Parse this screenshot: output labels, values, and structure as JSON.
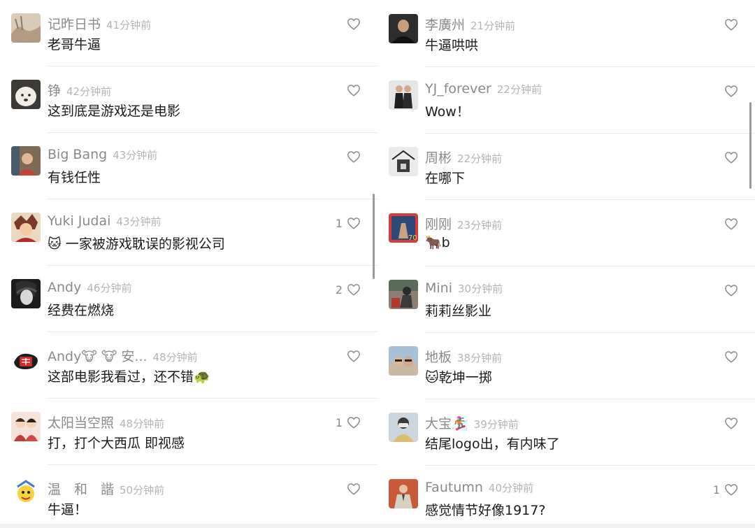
{
  "columns": [
    {
      "comments": [
        {
          "username": "记昨日书",
          "time": "41分钟前",
          "text": "老哥牛逼",
          "likes": "",
          "avatar_icon": "landscape-avatar-icon"
        },
        {
          "username": "铮",
          "time": "42分钟前",
          "text": "这到底是游戏还是电影",
          "likes": "",
          "avatar_icon": "dog-avatar-icon"
        },
        {
          "username": "Big Bang",
          "time": "43分钟前",
          "text": "有钱任性",
          "likes": "",
          "avatar_icon": "person-avatar-icon"
        },
        {
          "username": "Yuki Judai",
          "time": "43分钟前",
          "text": "🐱 一家被游戏耽误的影视公司",
          "likes": "1",
          "avatar_icon": "anime-avatar-icon"
        },
        {
          "username": "Andy",
          "time": "46分钟前",
          "text": "经费在燃烧",
          "likes": "2",
          "avatar_icon": "bw-portrait-avatar-icon"
        },
        {
          "username": "Andy🐮 🐮 安...",
          "time": "48分钟前",
          "text": "这部电影我看过，还不错🐢",
          "likes": "",
          "avatar_icon": "seal-logo-avatar-icon"
        },
        {
          "username": "太阳当空照",
          "time": "48分钟前",
          "text": "打，打个大西瓜 即视感",
          "likes": "1",
          "avatar_icon": "couple-cartoon-avatar-icon"
        },
        {
          "username": "温　和　諧",
          "time": "50分钟前",
          "text": "牛逼！",
          "likes": "",
          "avatar_icon": "cartoon-character-avatar-icon"
        }
      ]
    },
    {
      "comments": [
        {
          "username": "李廣州",
          "time": "21分钟前",
          "text": "牛逼哄哄",
          "likes": "",
          "avatar_icon": "man-portrait-avatar-icon"
        },
        {
          "username": "YJ_forever",
          "time": "22分钟前",
          "text": "Wow！",
          "likes": "",
          "avatar_icon": "couple-photo-avatar-icon"
        },
        {
          "username": "周彬",
          "time": "22分钟前",
          "text": "在哪下",
          "likes": "",
          "avatar_icon": "sketch-house-avatar-icon"
        },
        {
          "username": "刚刚",
          "time": "23分钟前",
          "text": "🐂b",
          "likes": "",
          "avatar_icon": "poster-avatar-icon"
        },
        {
          "username": "Mini",
          "time": "30分钟前",
          "text": "莉莉丝影业",
          "likes": "",
          "avatar_icon": "street-photo-avatar-icon"
        },
        {
          "username": "地板",
          "time": "38分钟前",
          "text": "🐱乾坤一掷",
          "likes": "",
          "avatar_icon": "selfie-avatar-icon"
        },
        {
          "username": "大宝🏂",
          "time": "39分钟前",
          "text": "结尾logo出，有内味了",
          "likes": "",
          "avatar_icon": "masked-person-avatar-icon"
        },
        {
          "username": "Fautumn",
          "time": "40分钟前",
          "text": "感觉情节好像1917?",
          "likes": "1",
          "avatar_icon": "suit-portrait-avatar-icon"
        }
      ]
    }
  ],
  "colors": {
    "username": "#8a8a8a",
    "time": "#b4b4b4",
    "text": "#1a1a1a",
    "heart": "#8a8a8a",
    "divider": "#e9e9e9"
  }
}
